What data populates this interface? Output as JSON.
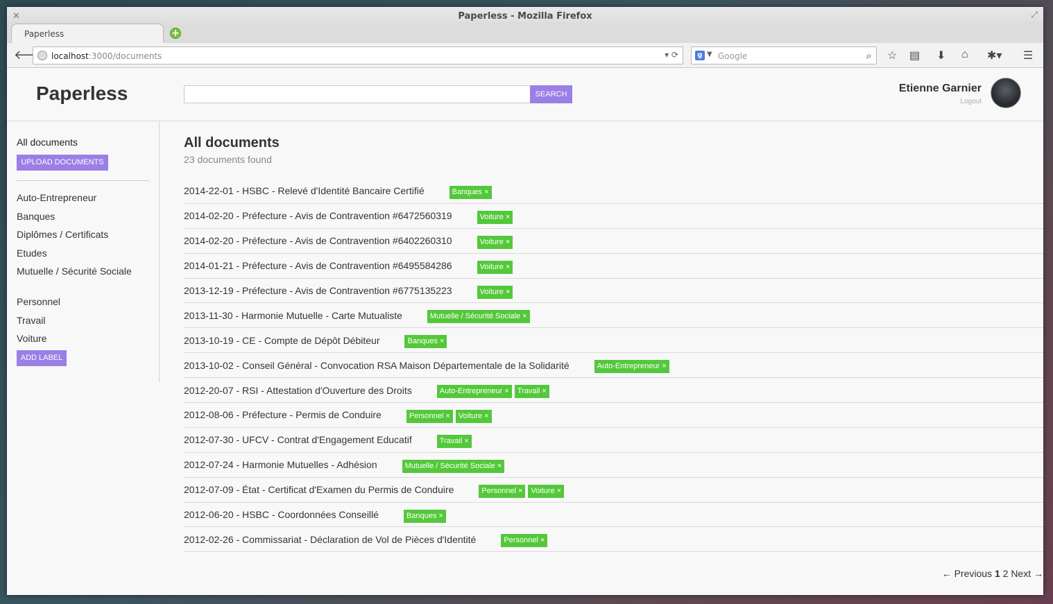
{
  "browser": {
    "window_title": "Paperless - Mozilla Firefox",
    "tab_label": "Paperless",
    "url_host": "localhost",
    "url_path": ":3000/documents",
    "search_placeholder": "Google"
  },
  "app": {
    "logo": "Paperless",
    "search_button": "SEARCH",
    "user_name": "Etienne Garnier",
    "logout": "Logout"
  },
  "sidebar": {
    "heading": "All documents",
    "upload_button": "UPLOAD DOCUMENTS",
    "labels_group1": [
      "Auto-Entrepreneur",
      "Banques",
      "Diplômes / Certificats",
      "Etudes",
      "Mutuelle / Sécurité Sociale"
    ],
    "labels_group2": [
      "Personnel",
      "Travail",
      "Voiture"
    ],
    "add_label_button": "ADD LABEL"
  },
  "main": {
    "title": "All documents",
    "count": "23 documents found",
    "documents": [
      {
        "name": "2014-22-01 - HSBC - Relevé d'Identité Bancaire Certifié",
        "tags": [
          "Banques ×"
        ]
      },
      {
        "name": "2014-02-20 - Préfecture - Avis de Contravention #6472560319",
        "tags": [
          "Voiture ×"
        ]
      },
      {
        "name": "2014-02-20 - Préfecture - Avis de Contravention #6402260310",
        "tags": [
          "Voiture ×"
        ]
      },
      {
        "name": "2014-01-21 - Préfecture - Avis de Contravention #6495584286",
        "tags": [
          "Voiture ×"
        ]
      },
      {
        "name": "2013-12-19 - Préfecture - Avis de Contravention #6775135223",
        "tags": [
          "Voiture ×"
        ]
      },
      {
        "name": "2013-11-30 - Harmonie Mutuelle - Carte Mutualiste",
        "tags": [
          "Mutuelle / Sécurité Sociale ×"
        ]
      },
      {
        "name": "2013-10-19 - CE - Compte de Dépôt Débiteur",
        "tags": [
          "Banques ×"
        ]
      },
      {
        "name": "2013-10-02 - Conseil Général - Convocation RSA Maison Départementale de la Solidarité",
        "tags": [
          "Auto-Entrepreneur ×"
        ]
      },
      {
        "name": "2012-20-07 - RSI - Attestation d'Ouverture des Droits",
        "tags": [
          "Auto-Entrepreneur ×",
          "Travail ×"
        ]
      },
      {
        "name": "2012-08-06 - Préfecture - Permis de Conduire",
        "tags": [
          "Personnel ×",
          "Voiture ×"
        ]
      },
      {
        "name": "2012-07-30 - UFCV - Contrat d'Engagement Educatif",
        "tags": [
          "Travail ×"
        ]
      },
      {
        "name": "2012-07-24 - Harmonie Mutuelles - Adhésion",
        "tags": [
          "Mutuelle / Sécurité Sociale ×"
        ]
      },
      {
        "name": "2012-07-09 - État - Certificat d'Examen du Permis de Conduire",
        "tags": [
          "Personnel ×",
          "Voiture ×"
        ]
      },
      {
        "name": "2012-06-20 - HSBC - Coordonnées Conseillé",
        "tags": [
          "Banques ×"
        ]
      },
      {
        "name": "2012-02-26 - Commissariat - Déclaration de Vol de Pièces d'Identité",
        "tags": [
          "Personnel ×"
        ]
      }
    ],
    "pager": {
      "previous": "← Previous",
      "page1": "1",
      "page2": "2",
      "next": "Next →"
    }
  },
  "colors": {
    "accent": "#9b7fe6",
    "tag": "#53c83a"
  }
}
